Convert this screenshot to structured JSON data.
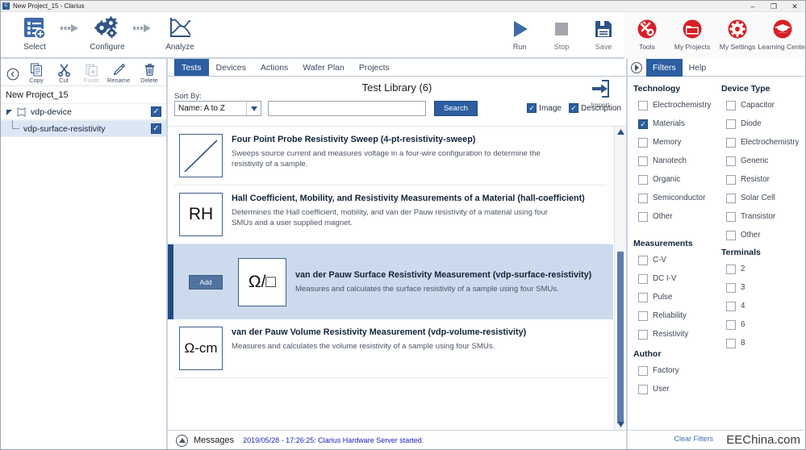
{
  "window": {
    "title": "New Project_15 - Clarius",
    "app_icon": "clarius-app-icon",
    "minimize": "–",
    "maximize": "❐",
    "close": "✕"
  },
  "ribbon": {
    "flow": [
      {
        "label": "Select",
        "icon": "select-list-plus-icon"
      },
      {
        "label": "Configure",
        "icon": "gears-icon"
      },
      {
        "label": "Analyze",
        "icon": "graph-curve-icon"
      }
    ],
    "commands": [
      {
        "label": "Run",
        "icon": "play-triangle-icon"
      },
      {
        "label": "Stop",
        "icon": "stop-square-icon"
      },
      {
        "label": "Save",
        "icon": "floppy-disk-icon"
      }
    ],
    "red_commands": [
      {
        "label": "Tools",
        "icon": "tools-wrench-screwdriver-icon"
      },
      {
        "label": "My Projects",
        "icon": "folder-icon"
      },
      {
        "label": "My Settings",
        "icon": "gear-icon"
      },
      {
        "label": "Learning Center",
        "icon": "graduation-cap-icon"
      }
    ]
  },
  "left_panel": {
    "tools": [
      {
        "label": "",
        "icon": "back-arrow-icon",
        "disabled": false
      },
      {
        "label": "Copy",
        "icon": "copy-icon",
        "disabled": false
      },
      {
        "label": "Cut",
        "icon": "scissors-icon",
        "disabled": false
      },
      {
        "label": "Paste",
        "icon": "paste-icon",
        "disabled": true
      },
      {
        "label": "Rename",
        "icon": "pencil-icon",
        "disabled": false
      },
      {
        "label": "Delete",
        "icon": "trash-icon",
        "disabled": false
      }
    ],
    "project_name": "New Project_15",
    "tree": [
      {
        "label": "vdp-device",
        "checked": true,
        "level": 0,
        "icon": "device-icon",
        "check_mark": "✓"
      },
      {
        "label": "vdp-surface-resistivity",
        "checked": true,
        "level": 1,
        "selected": true,
        "check_mark": "✓"
      }
    ]
  },
  "center": {
    "tabs": [
      {
        "label": "Tests",
        "active": true
      },
      {
        "label": "Devices",
        "active": false
      },
      {
        "label": "Actions",
        "active": false
      },
      {
        "label": "Wafer Plan",
        "active": false
      },
      {
        "label": "Projects",
        "active": false
      }
    ],
    "library_title": "Test Library (6)",
    "sort_label": "Sort By:",
    "sort_value": "Name: A to Z",
    "sort_caret": "▼",
    "search_value": "",
    "search_placeholder": "",
    "search_button": "Search",
    "import_label": "Import",
    "import_icon": "import-arrow-icon",
    "toggles": [
      {
        "label": "Image",
        "checked": true
      },
      {
        "label": "Description",
        "checked": true
      }
    ],
    "check_mark": "✓",
    "tests": [
      {
        "title": "Four Point Probe Resistivity Sweep (4-pt-resistivity-sweep)",
        "description": "Sweeps source current and measures voltage in a four-wire configuration to determine the resistivity of a sample.",
        "thumb": "diagonal-line-icon",
        "thumb_text": "",
        "selected": false
      },
      {
        "title": "Hall Coefficient, Mobility, and Resistivity Measurements of a Material (hall-coefficient)",
        "description": "Determines the Hall coefficient, mobility, and van der Pauw resistivity of a material using four SMUs and a user supplied magnet.",
        "thumb": "rh-text-icon",
        "thumb_text": "RH",
        "selected": false
      },
      {
        "title": "van der Pauw Surface Resistivity Measurement (vdp-surface-resistivity)",
        "description": "Measures and calculates the surface resistivity of a sample using four SMUs.",
        "thumb": "ohm-per-square-icon",
        "thumb_text": "Ω/□",
        "selected": true,
        "add_label": "Add"
      },
      {
        "title": "van der Pauw Volume Resistivity Measurement (vdp-volume-resistivity)",
        "description": "Measures and calculates the volume resistivity of a sample using four SMUs.",
        "thumb": "ohm-cm-icon",
        "thumb_text": "Ω-cm",
        "selected": false
      }
    ],
    "scroll_up": "▲",
    "scroll_down": "▼"
  },
  "messages": {
    "toggle_icon": "chevron-up-icon",
    "label": "Messages",
    "text": "2019/05/28 - 17:26:25: Clarius Hardware Server started."
  },
  "right_panel": {
    "collapse_icon": "chevron-right-icon",
    "tabs": [
      {
        "label": "Filters",
        "active": true
      },
      {
        "label": "Help",
        "active": false
      }
    ],
    "groups": [
      {
        "title": "Technology",
        "column": 0,
        "items": [
          {
            "label": "Electrochemistry",
            "checked": false
          },
          {
            "label": "Materials",
            "checked": true
          },
          {
            "label": "Memory",
            "checked": false
          },
          {
            "label": "Nanotech",
            "checked": false
          },
          {
            "label": "Organic",
            "checked": false
          },
          {
            "label": "Semiconductor",
            "checked": false
          },
          {
            "label": "Other",
            "checked": false
          }
        ]
      },
      {
        "title": "Device Type",
        "column": 1,
        "items": [
          {
            "label": "Capacitor",
            "checked": false
          },
          {
            "label": "Diode",
            "checked": false
          },
          {
            "label": "Electrochemistry",
            "checked": false
          },
          {
            "label": "Generic",
            "checked": false
          },
          {
            "label": "Resistor",
            "checked": false
          },
          {
            "label": "Solar Cell",
            "checked": false
          },
          {
            "label": "Transistor",
            "checked": false
          },
          {
            "label": "Other",
            "checked": false
          }
        ]
      },
      {
        "title": "Measurements",
        "column": 0,
        "items": [
          {
            "label": "C-V",
            "checked": false
          },
          {
            "label": "DC I-V",
            "checked": false
          },
          {
            "label": "Pulse",
            "checked": false
          },
          {
            "label": "Reliability",
            "checked": false
          },
          {
            "label": "Resistivity",
            "checked": false
          }
        ]
      },
      {
        "title": "Terminals",
        "column": 1,
        "items": [
          {
            "label": "2",
            "checked": false
          },
          {
            "label": "3",
            "checked": false
          },
          {
            "label": "4",
            "checked": false
          },
          {
            "label": "6",
            "checked": false
          },
          {
            "label": "8",
            "checked": false
          }
        ]
      },
      {
        "title": "Author",
        "column": 0,
        "items": [
          {
            "label": "Factory",
            "checked": false
          },
          {
            "label": "User",
            "checked": false
          }
        ]
      }
    ],
    "check_mark": "✓",
    "clear_filters": "Clear Filters"
  },
  "watermark": "EEChina.com",
  "colors": {
    "accent_blue": "#2c5ea0",
    "dark_blue": "#1f4c85",
    "red": "#d81f26",
    "selected_row": "#ccdaee",
    "link_blue": "#2020c0"
  }
}
